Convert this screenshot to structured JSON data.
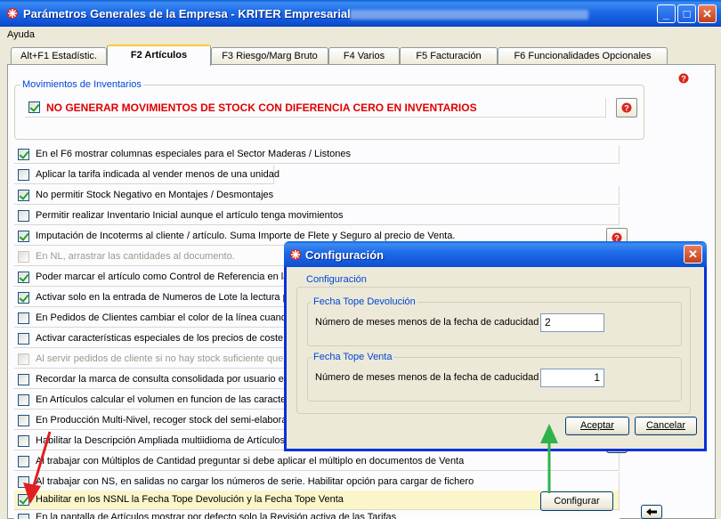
{
  "window": {
    "title": "Parámetros Generales de la Empresa - KRITER Empresarial",
    "minimize": "_",
    "maximize": "□",
    "close": "✕"
  },
  "menu": {
    "items": [
      "Ayuda"
    ]
  },
  "tabs": [
    {
      "label": "Alt+F1 Estadístic.",
      "active": false
    },
    {
      "label": "F2 Artículos",
      "active": true
    },
    {
      "label": "F3 Riesgo/Marg Bruto",
      "active": false
    },
    {
      "label": "F4 Varios",
      "active": false
    },
    {
      "label": "F5 Facturación",
      "active": false
    },
    {
      "label": "F6 Funcionalidades Opcionales",
      "active": false
    }
  ],
  "inventory_group": {
    "label": "Movimientos de Inventarios",
    "option": {
      "label": "NO GENERAR MOVIMIENTOS DE STOCK CON DIFERENCIA CERO EN INVENTARIOS",
      "checked": true
    }
  },
  "options": [
    {
      "label": "En el F6 mostrar columnas especiales para el Sector Maderas / Listones",
      "checked": true,
      "disabled": false
    },
    {
      "label": "Aplicar la tarifa indicada al vender menos de una unidad",
      "checked": false,
      "disabled": false
    },
    {
      "label": "No permitir Stock Negativo en Montajes / Desmontajes",
      "checked": true,
      "disabled": false
    },
    {
      "label": "Permitir realizar Inventario Inicial aunque el artículo tenga movimientos",
      "checked": false,
      "disabled": false
    },
    {
      "label": "Imputación de Incoterms al cliente / artículo.  Suma Importe de Flete y Seguro al precio de Venta.",
      "checked": true,
      "disabled": false
    },
    {
      "label": "En NL, arrastrar las cantidades al documento.",
      "checked": false,
      "disabled": true
    },
    {
      "label": "Poder marcar el artículo como Control de Referencia en la v",
      "checked": true,
      "disabled": false
    },
    {
      "label": "Activar solo en la entrada de Numeros de Lote la lectura po",
      "checked": true,
      "disabled": false
    },
    {
      "label": "En Pedidos de Clientes cambiar el color de la línea cuando",
      "checked": false,
      "disabled": false
    },
    {
      "label": "Activar características especiales de los precios de coste",
      "checked": false,
      "disabled": false
    },
    {
      "label": "Al servir pedidos de cliente si no hay stock suficiente que s",
      "checked": false,
      "disabled": true
    },
    {
      "label": "Recordar la marca de consulta consolidada por usuario en",
      "checked": false,
      "disabled": false
    },
    {
      "label": "En Artículos calcular el volumen en funcion de las caracter",
      "checked": false,
      "disabled": false
    },
    {
      "label": "En Producción Multi-Nivel, recoger stock del semi-elaborad",
      "checked": false,
      "disabled": false
    },
    {
      "label": "Habilitar la Descripción Ampliada multiidioma de Artículos",
      "checked": false,
      "disabled": false
    },
    {
      "label": "Al trabajar con Múltiplos de Cantidad preguntar si debe aplicar el múltiplo en documentos de Venta",
      "checked": false,
      "disabled": false
    },
    {
      "label": "Al trabajar con NS, en salidas no cargar los números de serie. Habilitar opción para cargar de fichero",
      "checked": false,
      "disabled": false
    },
    {
      "label": "Habilitar en los NSNL la Fecha Tope Devolución y la Fecha Tope Venta",
      "checked": true,
      "disabled": false
    },
    {
      "label": "En la pantalla de Artículos mostrar por defecto solo la Revisión activa de las Tarifas",
      "checked": false,
      "disabled": false
    }
  ],
  "configure_button": "Configurar",
  "dialog": {
    "title": "Configuración",
    "close": "✕",
    "group_label": "Configuración",
    "return_group": {
      "label": "Fecha Tope Devolución",
      "field_label": "Número de meses menos de la fecha de caducidad",
      "value": "2"
    },
    "sale_group": {
      "label": "Fecha Tope Venta",
      "field_label": "Número de meses menos de la fecha de caducidad",
      "value": "1"
    },
    "accept": "Aceptar",
    "cancel": "Cancelar"
  },
  "colors": {
    "red_arrow": "#e02020",
    "green_arrow": "#2fb24a",
    "title_bar": "#0a5fd8",
    "group_label": "#0046d5"
  }
}
